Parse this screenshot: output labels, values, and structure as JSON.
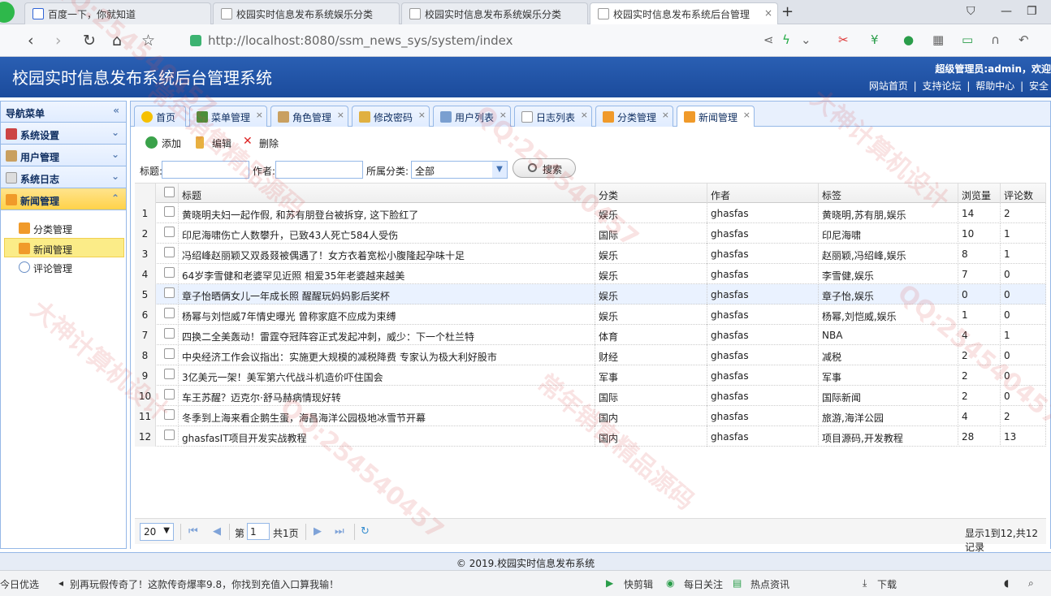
{
  "browser": {
    "tabs": [
      "百度一下，你就知道",
      "校园实时信息发布系统娱乐分类",
      "校园实时信息发布系统娱乐分类",
      "校园实时信息发布系统后台管理"
    ],
    "url": "http://localhost:8080/ssm_news_sys/system/index"
  },
  "header": {
    "title": "校园实时信息发布系统后台管理系统",
    "welcome": "超级管理员:admin，欢迎",
    "links": [
      "网站首页",
      "|",
      "支持论坛",
      "|",
      "帮助中心",
      "|",
      "安全"
    ]
  },
  "sidebar": {
    "title": "导航菜单",
    "groups": [
      {
        "label": "系统设置"
      },
      {
        "label": "用户管理"
      },
      {
        "label": "系统日志"
      },
      {
        "label": "新闻管理"
      }
    ],
    "subitems": [
      {
        "label": "分类管理"
      },
      {
        "label": "新闻管理"
      },
      {
        "label": "评论管理"
      }
    ]
  },
  "tabs": [
    "首页",
    "菜单管理",
    "角色管理",
    "修改密码",
    "用户列表",
    "日志列表",
    "分类管理",
    "新闻管理"
  ],
  "toolbar": {
    "add": "添加",
    "edit": "编辑",
    "delete": "删除"
  },
  "filters": {
    "title_label": "标题:",
    "author_label": "作者:",
    "category_label": "所属分类:",
    "category_value": "全部",
    "search": "搜索"
  },
  "table": {
    "columns": [
      "标题",
      "分类",
      "作者",
      "标签",
      "浏览量",
      "评论数"
    ],
    "rows": [
      {
        "n": "1",
        "title": "黄晓明夫妇一起作假, 和苏有朋登台被拆穿, 这下脸红了",
        "cat": "娱乐",
        "author": "ghasfas",
        "tags": "黄晓明,苏有朋,娱乐",
        "views": "14",
        "comments": "2"
      },
      {
        "n": "2",
        "title": "印尼海啸伤亡人数攀升，已致43人死亡584人受伤",
        "cat": "国际",
        "author": "ghasfas",
        "tags": "印尼海啸",
        "views": "10",
        "comments": "1"
      },
      {
        "n": "3",
        "title": "冯绍峰赵丽颖又双叒叕被偶遇了！女方衣着宽松小腹隆起孕味十足",
        "cat": "娱乐",
        "author": "ghasfas",
        "tags": "赵丽颖,冯绍峰,娱乐",
        "views": "8",
        "comments": "1"
      },
      {
        "n": "4",
        "title": "64岁李雪健和老婆罕见近照 相爱35年老婆越来越美",
        "cat": "娱乐",
        "author": "ghasfas",
        "tags": "李雪健,娱乐",
        "views": "7",
        "comments": "0"
      },
      {
        "n": "5",
        "title": "章子怡晒俩女儿一年成长照 醒醒玩妈妈影后奖杯",
        "cat": "娱乐",
        "author": "ghasfas",
        "tags": "章子怡,娱乐",
        "views": "0",
        "comments": "0"
      },
      {
        "n": "6",
        "title": "杨幂与刘恺威7年情史曝光 曾称家庭不应成为束缚",
        "cat": "娱乐",
        "author": "ghasfas",
        "tags": "杨幂,刘恺威,娱乐",
        "views": "1",
        "comments": "0"
      },
      {
        "n": "7",
        "title": "四换二全美轰动！雷霆夺冠阵容正式发起冲刺，威少：下一个杜兰特",
        "cat": "体育",
        "author": "ghasfas",
        "tags": "NBA",
        "views": "4",
        "comments": "1"
      },
      {
        "n": "8",
        "title": "中央经济工作会议指出：实施更大规模的减税降费 专家认为极大利好股市",
        "cat": "财经",
        "author": "ghasfas",
        "tags": "减税",
        "views": "2",
        "comments": "0"
      },
      {
        "n": "9",
        "title": "3亿美元一架！美军第六代战斗机造价吓住国会",
        "cat": "军事",
        "author": "ghasfas",
        "tags": "军事",
        "views": "2",
        "comments": "0"
      },
      {
        "n": "10",
        "title": "车王苏醒？迈克尔·舒马赫病情现好转",
        "cat": "国际",
        "author": "ghasfas",
        "tags": "国际新闻",
        "views": "2",
        "comments": "0"
      },
      {
        "n": "11",
        "title": "冬季到上海来看企鹅生蛋，海昌海洋公园极地冰雪节开幕",
        "cat": "国内",
        "author": "ghasfas",
        "tags": "旅游,海洋公园",
        "views": "4",
        "comments": "2"
      },
      {
        "n": "12",
        "title": "ghasfasIT项目开发实战教程",
        "cat": "国内",
        "author": "ghasfas",
        "tags": "项目源码,开发教程",
        "views": "28",
        "comments": "13"
      }
    ]
  },
  "pager": {
    "page_size": "20",
    "page_prefix": "第",
    "page_value": "1",
    "page_total": "共1页",
    "summary": "显示1到12,共12记录"
  },
  "footer": "© 2019.校园实时信息发布系统",
  "statusbar": {
    "left": "今日优选",
    "ad": "别再玩假传奇了！这款传奇爆率9.8，你找到充值入口算我输！",
    "items": [
      "快剪辑",
      "每日关注",
      "热点资讯",
      "下载"
    ]
  },
  "watermarks": [
    "QQ:254540457",
    "常年销售精品源码",
    "大神计算机设计",
    "QQ:254540457",
    "常年销售精品源码",
    "大神计算机设计",
    "QQ:254540457",
    "QQ:254540457"
  ]
}
